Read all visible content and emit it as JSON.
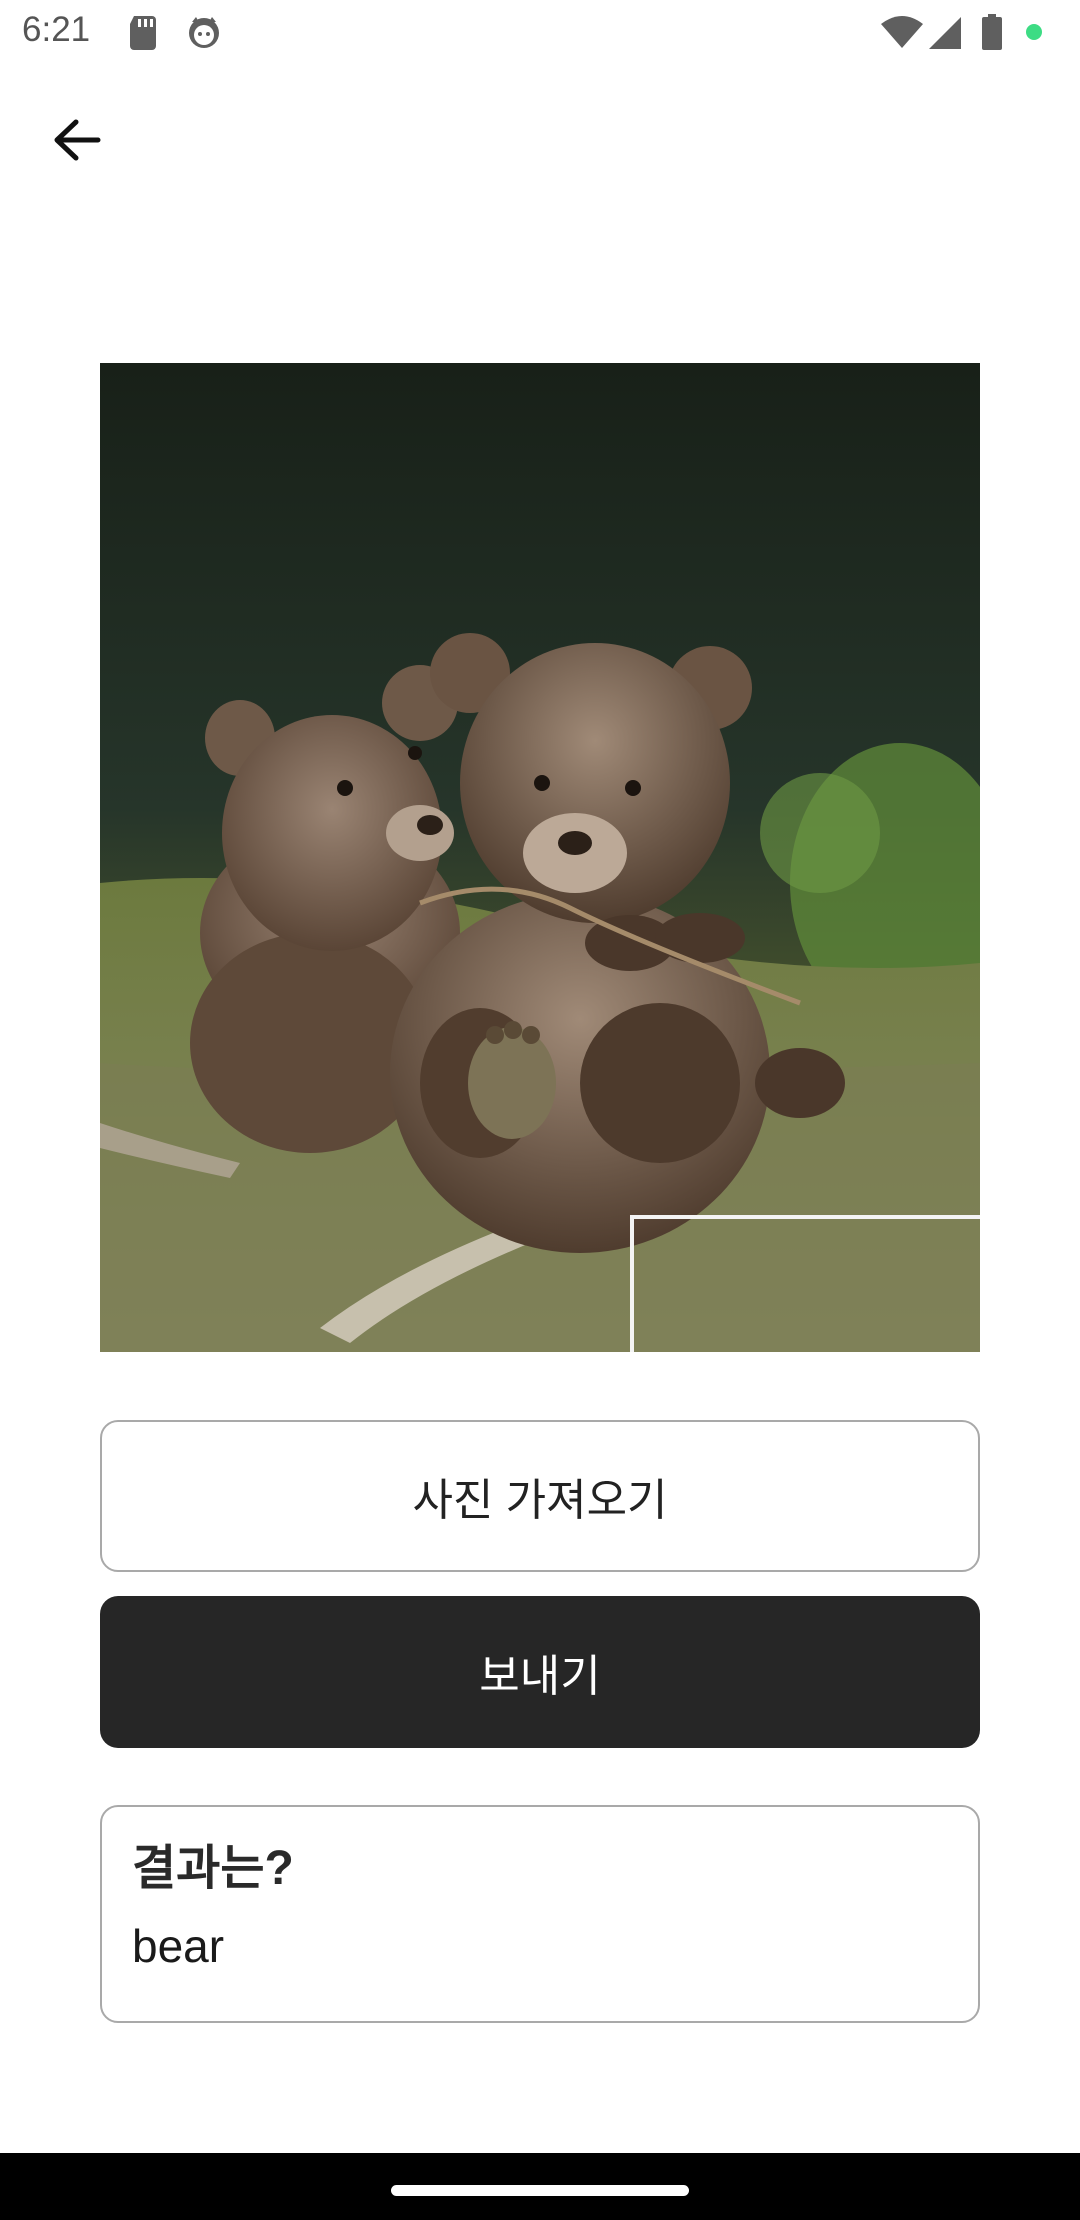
{
  "status_bar": {
    "time": "6:21",
    "icons": [
      "sd-card-icon",
      "cat-face-icon",
      "wifi-icon",
      "cell-signal-icon",
      "battery-icon",
      "green-dot-icon"
    ]
  },
  "toolbar": {
    "back_icon": "arrow-left-icon"
  },
  "photo": {
    "subject": "two brown bear cubs on grass",
    "colors": {
      "background": "#1f2b1f",
      "fur": "#6b5544",
      "grass": "#7e8a4a"
    }
  },
  "buttons": {
    "import_label": "사진 가져오기",
    "send_label": "보내기"
  },
  "result": {
    "title": "결과는?",
    "value": "bear"
  },
  "colors": {
    "send_button_bg": "#262626",
    "border": "#a9a9a9",
    "status_dot": "#3ddc84"
  }
}
